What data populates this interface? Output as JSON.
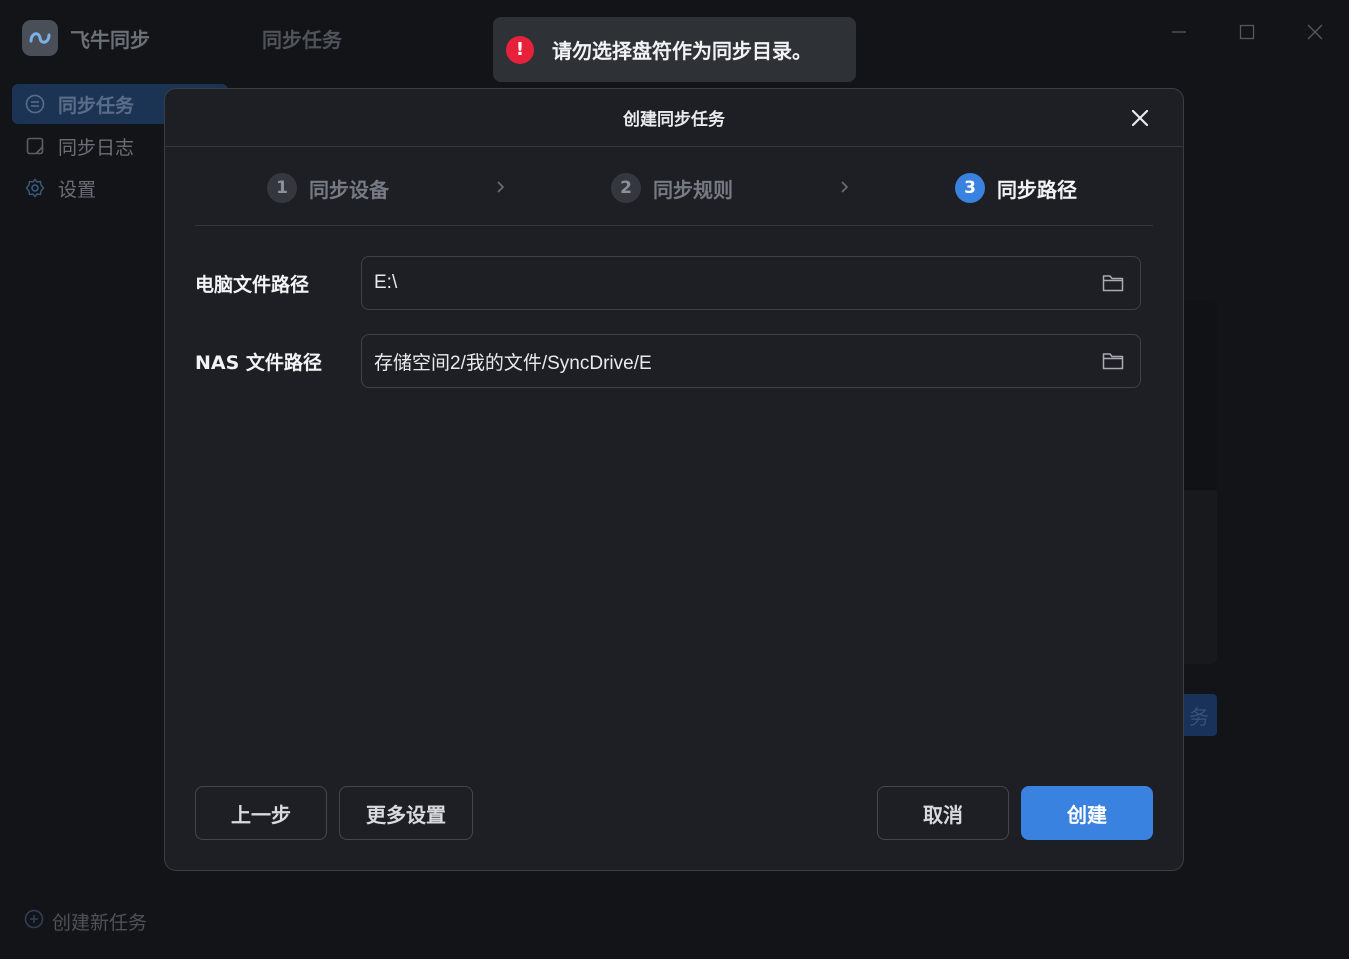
{
  "app": {
    "name": "飞牛同步"
  },
  "sidebar": {
    "items": [
      {
        "label": "同步任务",
        "icon": "sync-task-icon",
        "active": true
      },
      {
        "label": "同步日志",
        "icon": "log-icon",
        "active": false
      },
      {
        "label": "设置",
        "icon": "gear-icon",
        "active": false
      }
    ],
    "create_new": "创建新任务"
  },
  "main": {
    "title": "同步任务",
    "bg_button_fragment": "务"
  },
  "toast": {
    "icon": "!",
    "message": "请勿选择盘符作为同步目录。",
    "color": "#e8213a"
  },
  "dialog": {
    "title": "创建同步任务",
    "steps": [
      {
        "num": "1",
        "label": "同步设备"
      },
      {
        "num": "2",
        "label": "同步规则"
      },
      {
        "num": "3",
        "label": "同步路径"
      }
    ],
    "current_step": 3,
    "fields": {
      "pc_path": {
        "label": "电脑文件路径",
        "value": "E:\\"
      },
      "nas_path": {
        "label": "NAS 文件路径",
        "value": "存储空间2/我的文件/SyncDrive/E"
      }
    },
    "buttons": {
      "prev": "上一步",
      "more": "更多设置",
      "cancel": "取消",
      "create": "创建"
    }
  },
  "colors": {
    "accent": "#3a82e0",
    "error": "#e8213a",
    "dialog_bg": "#1d1f24"
  }
}
